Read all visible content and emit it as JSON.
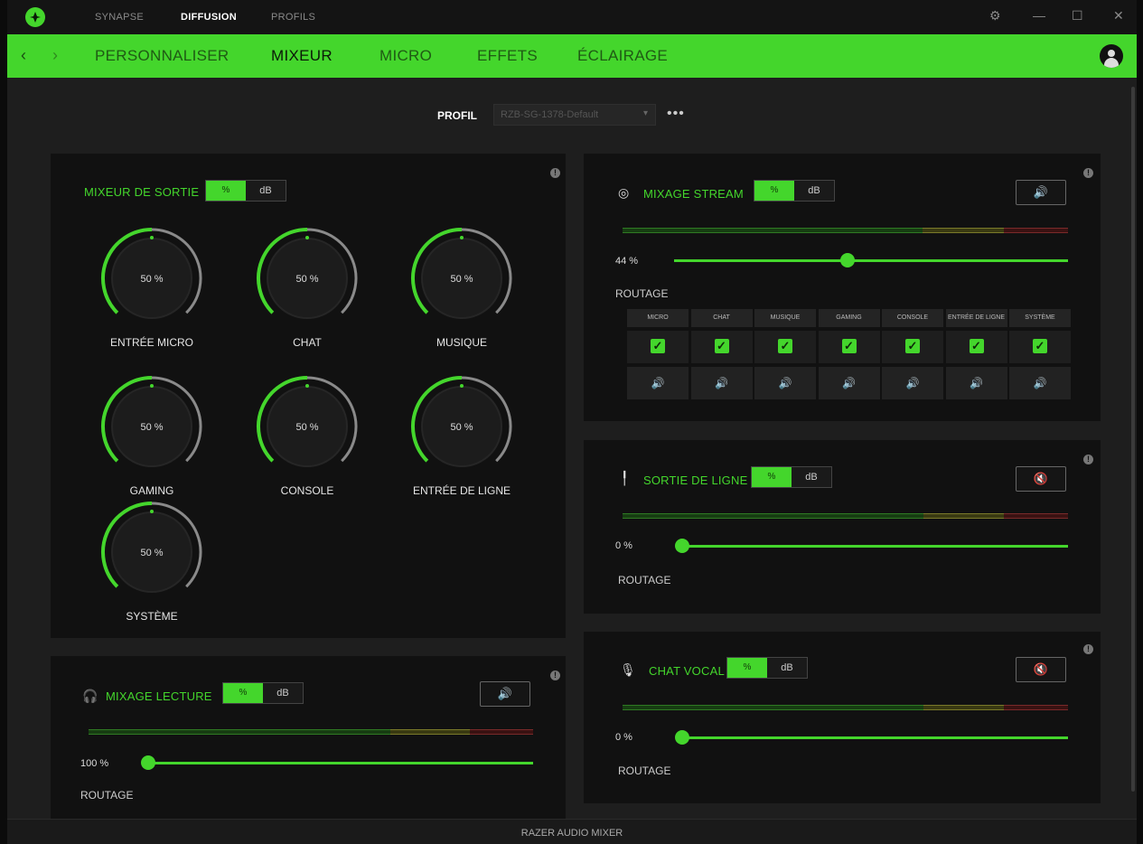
{
  "titlebar": {
    "tabs": [
      {
        "label": "SYNAPSE",
        "active": false
      },
      {
        "label": "DIFFUSION",
        "active": true
      },
      {
        "label": "PROFILS",
        "active": false
      }
    ],
    "controls": {
      "settings": "⚙",
      "minimize": "—",
      "maximize": "☐",
      "close": "✕"
    }
  },
  "nav": {
    "back": "‹",
    "forward": "›",
    "tabs": [
      {
        "label": "PERSONNALISER",
        "active": false
      },
      {
        "label": "MIXEUR",
        "active": true
      },
      {
        "label": "MICRO",
        "active": false
      },
      {
        "label": "EFFETS",
        "active": false
      },
      {
        "label": "ÉCLAIRAGE",
        "active": false
      }
    ]
  },
  "profile": {
    "label": "PROFIL",
    "value": "RZB-SG-1378-Default",
    "more": "•••"
  },
  "output_mixer": {
    "title": "MIXEUR DE SORTIE",
    "toggle": {
      "pct": "%",
      "db": "dB"
    },
    "knobs": [
      {
        "name": "ENTRÉE MICRO",
        "value": "50 %",
        "level": 0.5
      },
      {
        "name": "CHAT",
        "value": "50 %",
        "level": 0.5
      },
      {
        "name": "MUSIQUE",
        "value": "50 %",
        "level": 0.5
      },
      {
        "name": "GAMING",
        "value": "50 %",
        "level": 0.5
      },
      {
        "name": "CONSOLE",
        "value": "50 %",
        "level": 0.5
      },
      {
        "name": "ENTRÉE DE LIGNE",
        "value": "50 %",
        "level": 0.5
      },
      {
        "name": "SYSTÈME",
        "value": "50 %",
        "level": 0.5
      }
    ]
  },
  "playback_mix": {
    "title": "MIXAGE LECTURE",
    "toggle": {
      "pct": "%",
      "db": "dB"
    },
    "speaker": "🔊",
    "value_label": "100 %",
    "level": 0.0,
    "routage": "ROUTAGE"
  },
  "stream_mix": {
    "title": "MIXAGE STREAM",
    "toggle": {
      "pct": "%",
      "db": "dB"
    },
    "speaker": "🔊",
    "value_label": "44 %",
    "level": 0.44,
    "routage": "ROUTAGE",
    "routing": [
      {
        "header": "MICRO",
        "check": "✓",
        "speaker": "🔊"
      },
      {
        "header": "CHAT",
        "check": "✓",
        "speaker": "🔊"
      },
      {
        "header": "MUSIQUE",
        "check": "✓",
        "speaker": "🔊"
      },
      {
        "header": "GAMING",
        "check": "✓",
        "speaker": "🔊"
      },
      {
        "header": "CONSOLE",
        "check": "✓",
        "speaker": "🔊"
      },
      {
        "header": "ENTRÉE DE LIGNE",
        "check": "✓",
        "speaker": "🔊"
      },
      {
        "header": "SYSTÈME",
        "check": "✓",
        "speaker": "🔊"
      }
    ]
  },
  "line_out": {
    "title": "SORTIE DE LIGNE",
    "toggle": {
      "pct": "%",
      "db": "dB"
    },
    "speaker": "🔇",
    "value_label": "0 %",
    "level": 0.0,
    "routage": "ROUTAGE"
  },
  "voice_chat": {
    "title": "CHAT VOCAL",
    "toggle": {
      "pct": "%",
      "db": "dB"
    },
    "speaker": "🔇",
    "value_label": "0 %",
    "level": 0.0,
    "routage": "ROUTAGE"
  },
  "footer": {
    "label": "RAZER AUDIO MIXER"
  },
  "colors": {
    "accent": "#44d62c",
    "panel": "#111111",
    "background": "#1e1e1e"
  }
}
